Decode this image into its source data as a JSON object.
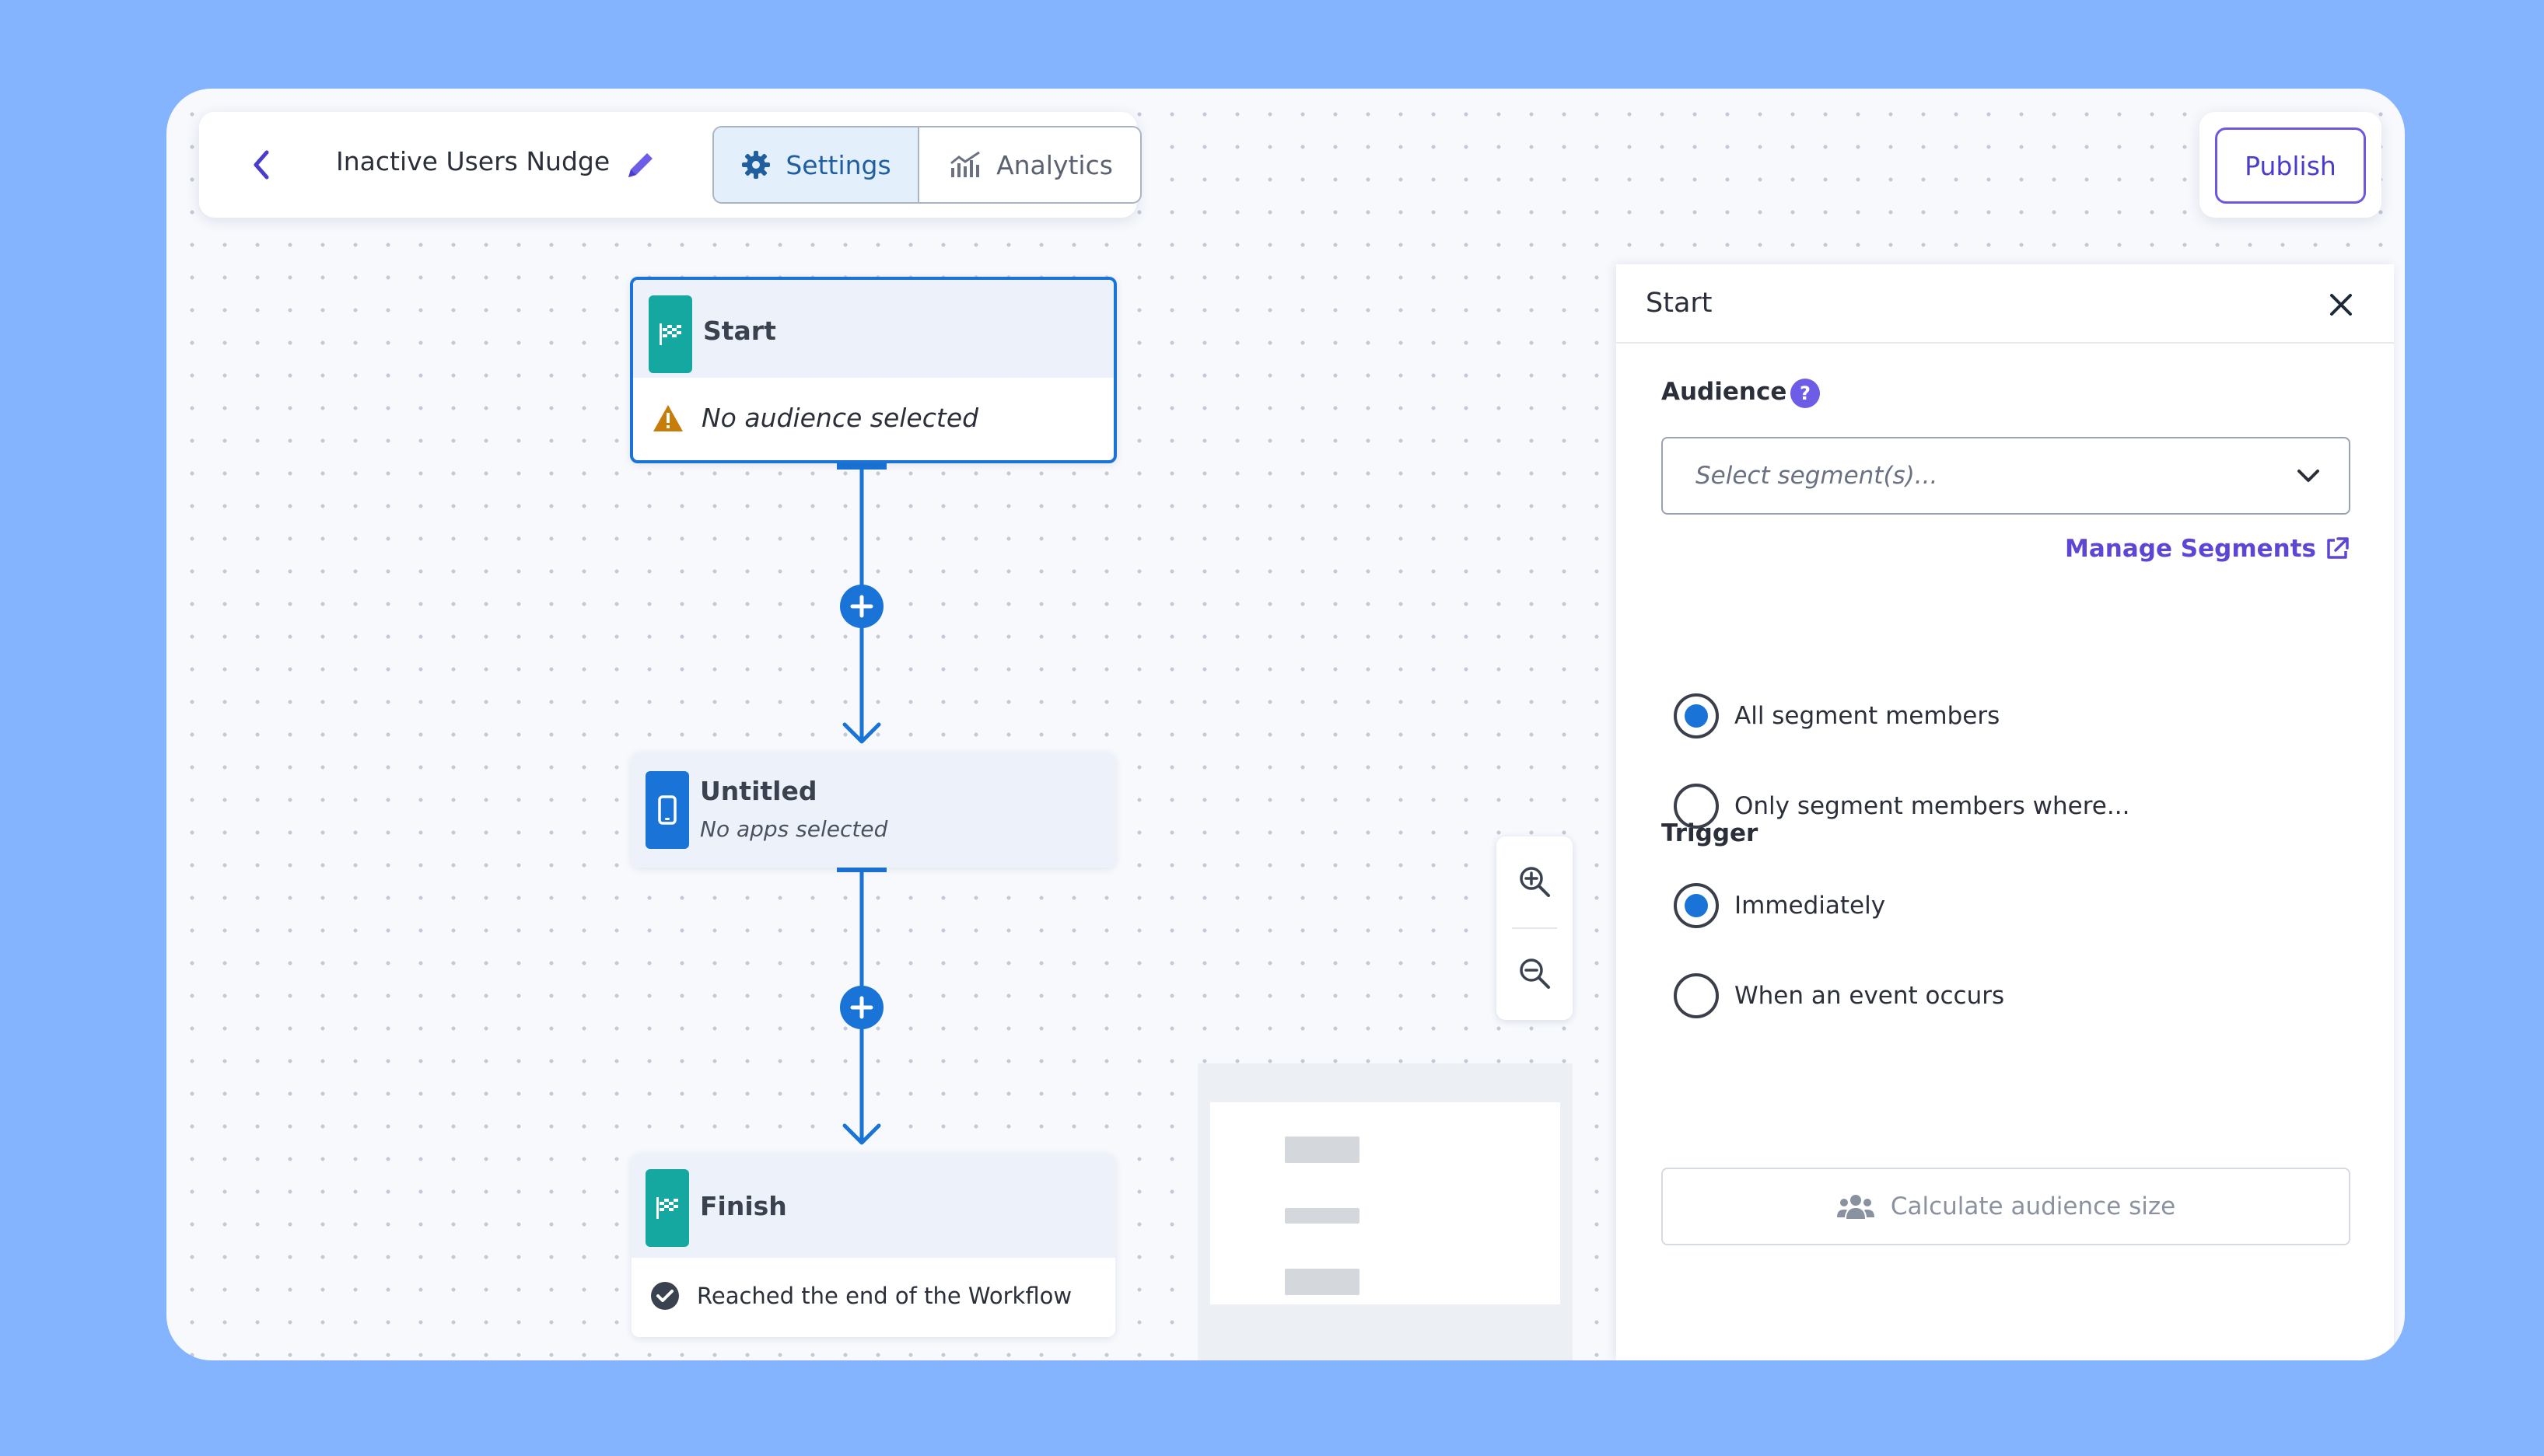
{
  "toolbar": {
    "workflow_title": "Inactive Users Nudge",
    "tabs": [
      {
        "label": "Settings",
        "active": true
      },
      {
        "label": "Analytics",
        "active": false
      }
    ],
    "publish_label": "Publish"
  },
  "canvas": {
    "nodes": {
      "start": {
        "title": "Start",
        "status": "No audience selected"
      },
      "untitled": {
        "title": "Untitled",
        "subtitle": "No apps selected"
      },
      "finish": {
        "title": "Finish",
        "status": "Reached the end of the Workflow"
      }
    }
  },
  "panel": {
    "title": "Start",
    "audience": {
      "label": "Audience",
      "help": "?",
      "select_placeholder": "Select segment(s)...",
      "manage_link": "Manage Segments",
      "options": [
        {
          "label": "All segment members",
          "checked": true
        },
        {
          "label": "Only segment members where...",
          "checked": false
        }
      ]
    },
    "trigger": {
      "label": "Trigger",
      "options": [
        {
          "label": "Immediately",
          "checked": true
        },
        {
          "label": "When an event occurs",
          "checked": false
        }
      ]
    },
    "calculate_label": "Calculate audience size"
  },
  "colors": {
    "background": "#85b4ff",
    "accent_blue": "#1a73d6",
    "accent_purple": "#5b46d6",
    "teal": "#14a8a0",
    "warning": "#c77d0a"
  }
}
